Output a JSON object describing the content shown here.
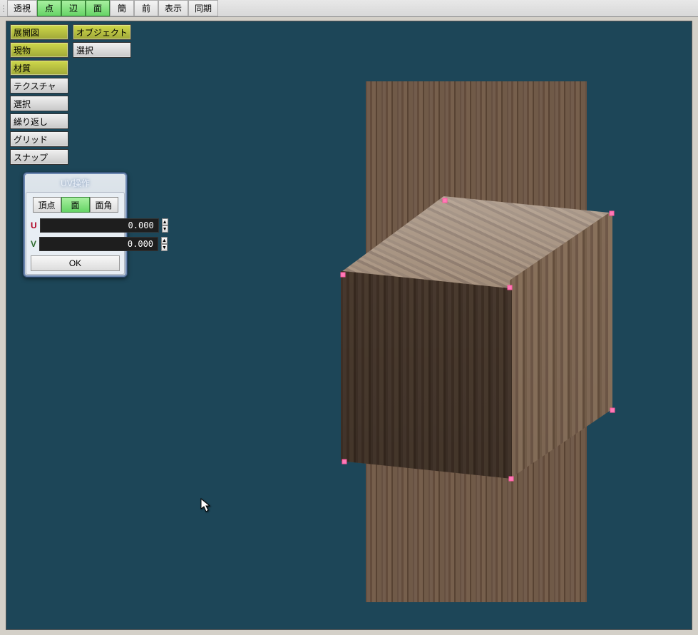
{
  "toolbar": {
    "perspective": "透視",
    "vertex": "点",
    "edge": "辺",
    "face": "面",
    "simple": "簡",
    "front": "前",
    "display": "表示",
    "sync": "同期"
  },
  "side": {
    "col1": {
      "uv_unwrap": "展開図",
      "actual": "現物",
      "material": "材質",
      "texture": "テクスチャ",
      "select": "選択",
      "repeat": "繰り返し",
      "grid": "グリッド",
      "snap": "スナップ"
    },
    "col2": {
      "object": "オブジェクト",
      "select": "選択"
    }
  },
  "uvpanel": {
    "title": "UV操作",
    "seg_vertex": "頂点",
    "seg_face": "面",
    "seg_corner": "面角",
    "u_label": "U",
    "v_label": "V",
    "u_value": "0.000",
    "v_value": "0.000",
    "ok": "OK"
  }
}
